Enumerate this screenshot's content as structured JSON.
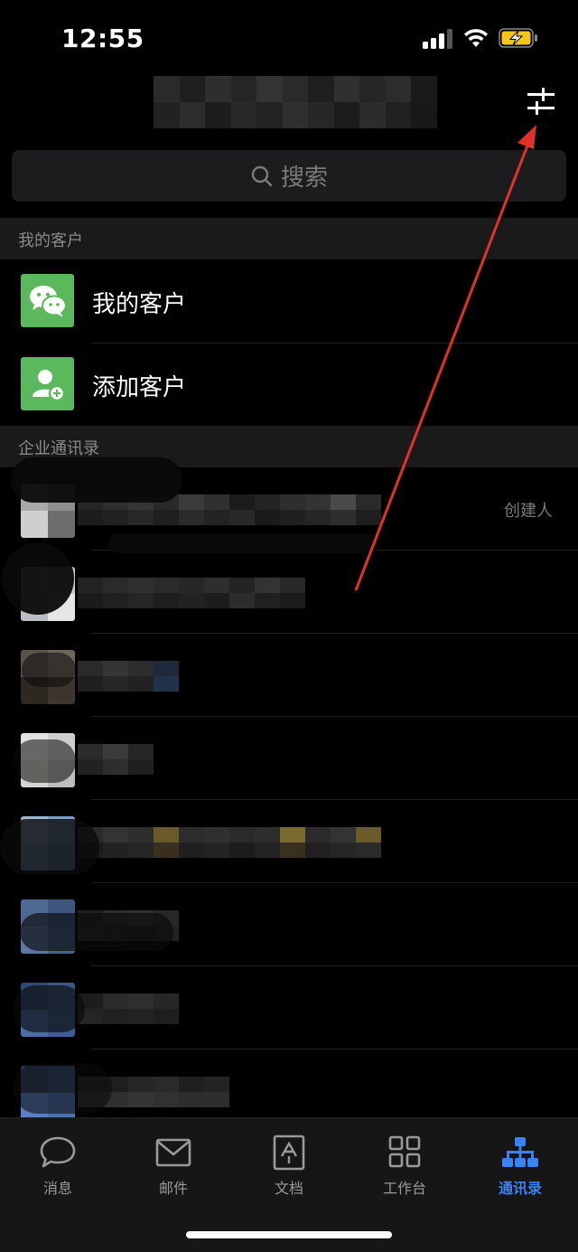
{
  "status_bar": {
    "time": "12:55",
    "icons": [
      "signal-icon",
      "wifi-icon",
      "battery-charging-icon"
    ]
  },
  "header": {
    "title": "",
    "filter_icon": "filter-sliders-icon"
  },
  "search": {
    "placeholder": "搜索",
    "icon": "search-icon"
  },
  "sections": {
    "customers": {
      "header": "我的客户",
      "items": [
        {
          "label": "我的客户",
          "icon": "wechat-icon"
        },
        {
          "label": "添加客户",
          "icon": "add-user-icon"
        }
      ]
    },
    "directory": {
      "header": "企业通讯录",
      "contacts": [
        {
          "tag": "创建人"
        },
        {
          "tag": ""
        },
        {
          "tag": ""
        },
        {
          "tag": ""
        },
        {
          "tag": ""
        },
        {
          "tag": ""
        },
        {
          "tag": ""
        },
        {
          "tag": ""
        }
      ]
    }
  },
  "tabbar": {
    "active": "contacts",
    "tabs": [
      {
        "id": "messages",
        "label": "消息",
        "icon": "chat-bubble-icon"
      },
      {
        "id": "mail",
        "label": "邮件",
        "icon": "mail-icon"
      },
      {
        "id": "docs",
        "label": "文档",
        "icon": "document-icon"
      },
      {
        "id": "workbench",
        "label": "工作台",
        "icon": "grid-apps-icon"
      },
      {
        "id": "contacts",
        "label": "通讯录",
        "icon": "org-chart-icon"
      }
    ]
  },
  "colors": {
    "accent": "#3b82f6",
    "green": "#5cb85c",
    "annotation_arrow": "#e0312b"
  }
}
